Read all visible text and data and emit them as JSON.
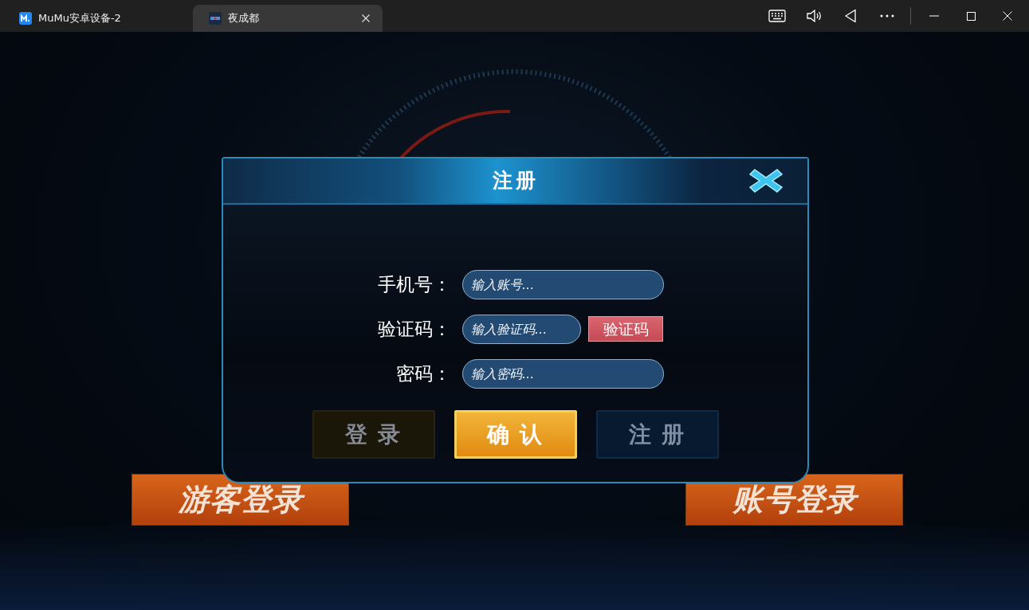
{
  "window": {
    "tabs": [
      {
        "label": "MuMu安卓设备-2",
        "selected": false,
        "closable": false,
        "kind": "app"
      },
      {
        "label": "夜成都",
        "selected": true,
        "closable": true,
        "kind": "game"
      }
    ]
  },
  "dialog": {
    "title": "注册",
    "fields": [
      {
        "label": "手机号：",
        "placeholder": "输入账号..."
      },
      {
        "label": "验证码：",
        "placeholder": "输入验证码...",
        "action": "验证码"
      },
      {
        "label": "密码：",
        "placeholder": "输入密码..."
      }
    ],
    "buttons": [
      {
        "label": "登 录",
        "disabled": true,
        "kind": "gold"
      },
      {
        "label": "确 认",
        "disabled": false,
        "kind": "gold"
      },
      {
        "label": "注 册",
        "disabled": true,
        "kind": "blue"
      }
    ]
  },
  "background_buttons": [
    {
      "label": "游客登录"
    },
    {
      "label": "账号登录"
    }
  ]
}
